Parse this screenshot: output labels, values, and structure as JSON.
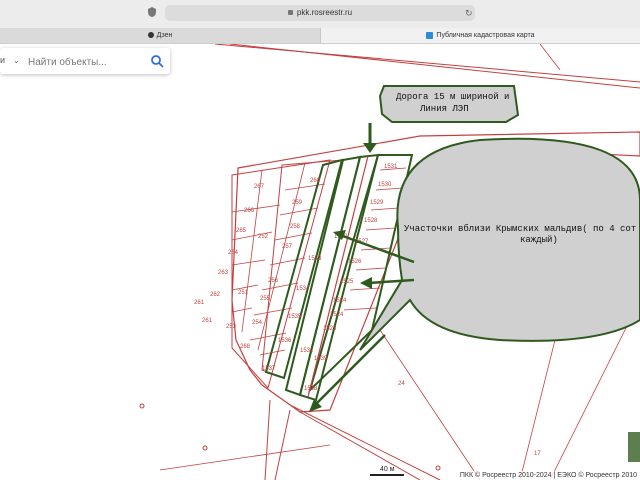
{
  "browser": {
    "url": "pkk.rosreestr.ru",
    "tabs": [
      {
        "label": "Дзен"
      },
      {
        "label": "Публичная кадастровая карта"
      }
    ]
  },
  "search": {
    "prefix": "и",
    "placeholder": "Найти объекты..."
  },
  "callouts": {
    "road": [
      "Дорога 15 м шириной и",
      "Линия ЛЭП"
    ],
    "plots": [
      "Участочки вблизи Крымских мальдив( по 4 сот",
      "каждый)"
    ]
  },
  "parcels": [
    "1531",
    "1530",
    "1529",
    "1528",
    "1527",
    "1526",
    "1525",
    "1524",
    "1524",
    "1523",
    "1539",
    "1538",
    "1537",
    "1536",
    "1535",
    "1534",
    "1533",
    "1532",
    "1540",
    "260",
    "259",
    "258",
    "257",
    "256",
    "255",
    "254",
    "268",
    "267",
    "266",
    "265",
    "264",
    "263",
    "262",
    "261",
    "261",
    "253",
    "252",
    "251",
    "24",
    "17"
  ],
  "scale": {
    "label": "40 м"
  },
  "footer": {
    "attribution": "ПКК © Росреестр 2010-2024 | ЕЭКО © Росреестр 2010"
  },
  "colors": {
    "boundary": "#c44040",
    "annotation": "#2f5a1e",
    "callout_fill": "#d0d0d0"
  }
}
